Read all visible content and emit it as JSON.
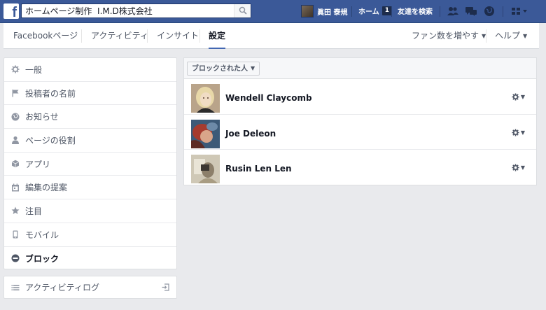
{
  "topbar": {
    "logo": "f",
    "search_value": "ホームページ制作  I.M.D株式会社",
    "user_name": "眞田 泰規",
    "home_label": "ホーム",
    "home_count": "1",
    "find_friends_label": "友達を検索"
  },
  "tabs": [
    {
      "label": "Facebookページ"
    },
    {
      "label": "アクティビティ"
    },
    {
      "label": "インサイト"
    },
    {
      "label": "設定"
    }
  ],
  "tabs_right": {
    "promote_label": "ファン数を増やす",
    "help_label": "ヘルプ"
  },
  "sidebar": {
    "items": [
      {
        "label": "一般",
        "icon": "gear-icon"
      },
      {
        "label": "投稿者の名前",
        "icon": "flag-icon"
      },
      {
        "label": "お知らせ",
        "icon": "globe-icon"
      },
      {
        "label": "ページの役割",
        "icon": "person-icon"
      },
      {
        "label": "アプリ",
        "icon": "cube-icon"
      },
      {
        "label": "編集の提案",
        "icon": "calendar-icon"
      },
      {
        "label": "注目",
        "icon": "star-icon"
      },
      {
        "label": "モバイル",
        "icon": "mobile-icon"
      },
      {
        "label": "ブロック",
        "icon": "block-icon"
      }
    ],
    "activity_log_label": "アクティビティログ"
  },
  "blocked": {
    "filter_label": "ブロックされた人",
    "people": [
      {
        "name": "Wendell Claycomb"
      },
      {
        "name": "Joe Deleon"
      },
      {
        "name": "Rusin Len Len"
      }
    ]
  },
  "colors": {
    "topbar": "#3b5998",
    "accent": "#4267b2",
    "background": "#e9eaed"
  }
}
